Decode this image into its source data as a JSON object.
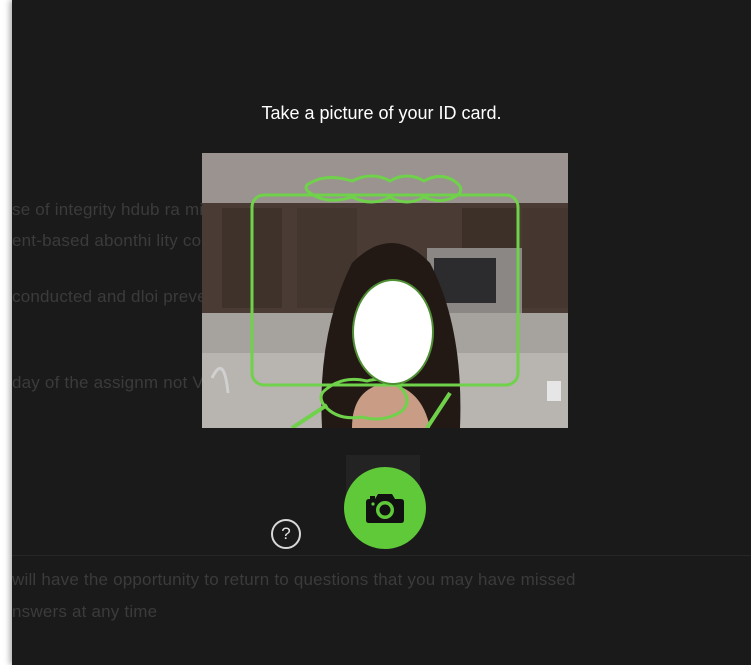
{
  "dialog": {
    "title": "Take a picture of your ID card.",
    "help_label": "?"
  },
  "background_text": {
    "line1": "se of integrity hdub                                              ra microphone ac",
    "line2": "ent-based abonthi                                                 lity content",
    "line3": "conducted and dloi                                                prevent your brow",
    "line4": "day of the assignm                                                  not Vasted abu",
    "line5": "will have the opportunity to return to questions that you may have missed",
    "line6": "nswers at any time"
  },
  "colors": {
    "accent": "#5fc93a",
    "modal_background": "#1a1a1a",
    "title_text": "#ffffff"
  },
  "icons": {
    "shutter": "camera-icon",
    "help": "question-mark-icon"
  }
}
